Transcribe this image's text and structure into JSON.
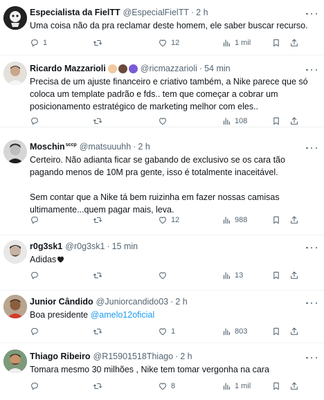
{
  "tweets": [
    {
      "name": "Especialista da FielTT",
      "handle": "@EspecialFielTT",
      "time": "2 h",
      "text": [
        "Uma coisa não da pra reclamar deste homem, ele saber buscar recurso."
      ],
      "replies": "1",
      "retweets": "",
      "likes": "12",
      "views": "1 mil"
    },
    {
      "name": "Ricardo Mazzarioli",
      "handle": "@ricmazzarioli",
      "time": "54 min",
      "text": [
        "Precisa de um ajuste financeiro e criativo também, a Nike parece que só coloca um template padrão e fds.. tem que começar a cobrar um posicionamento estratégico de marketing melhor com eles.."
      ],
      "replies": "",
      "retweets": "",
      "likes": "",
      "views": "108"
    },
    {
      "name": "Moschin",
      "name_sup": "sccp",
      "handle": "@matsuuuhh",
      "time": "2 h",
      "text": [
        "Certeiro. Não adianta ficar se gabando de exclusivo se os cara tão pagando menos de 10M pra gente, isso é totalmente inaceitável.",
        "",
        "Sem contar que a Nike tá bem ruizinha em fazer nossas camisas ultimamente...quem pagar mais, leva."
      ],
      "replies": "",
      "retweets": "",
      "likes": "12",
      "views": "988"
    },
    {
      "name": "r0g3sk1",
      "handle": "@r0g3sk1",
      "time": "15 min",
      "text": [
        "Adidas"
      ],
      "replies": "",
      "retweets": "",
      "likes": "",
      "views": "13"
    },
    {
      "name": "Junior Cândido",
      "handle": "@Juniorcandido03",
      "time": "2 h",
      "text_prefix": "Boa presidente ",
      "text_mention": "@amelo12oficial",
      "replies": "",
      "retweets": "",
      "likes": "1",
      "views": "803"
    },
    {
      "name": "Thiago Ribeiro",
      "handle": "@R15901518Thiago",
      "time": "2 h",
      "text": [
        "Tomara mesmo 30 milhões , Nike tem tomar vergonha na cara"
      ],
      "replies": "",
      "retweets": "",
      "likes": "8",
      "views": "1 mil"
    }
  ],
  "icons": {
    "reply": "reply-icon",
    "retweet": "retweet-icon",
    "like": "heart-icon",
    "views": "views-chart-icon",
    "bookmark": "bookmark-icon",
    "share": "share-icon",
    "more": "more-dots-icon"
  },
  "colors": {
    "text": "#0f1419",
    "secondary": "#536471",
    "link": "#1d9bf0",
    "divider": "#eff3f4"
  }
}
